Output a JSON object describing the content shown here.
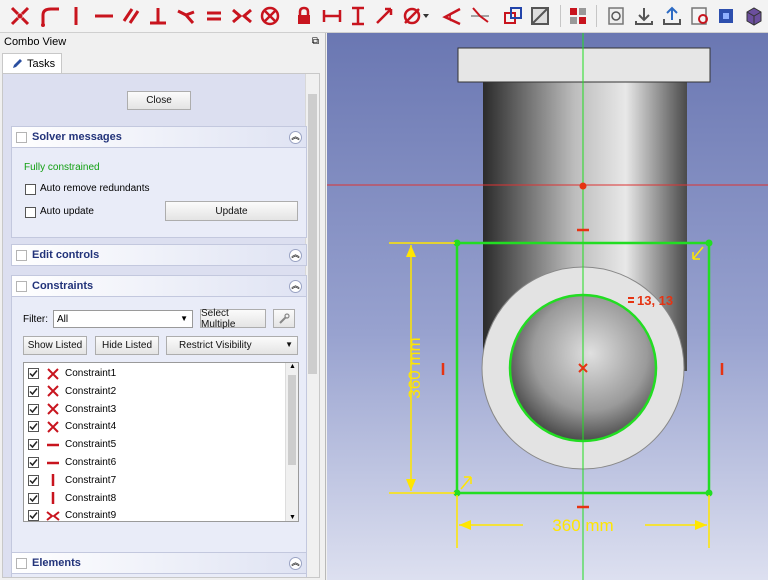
{
  "combo_view": {
    "title": "Combo View",
    "float_glyph": "⧉",
    "tab_label": "Tasks"
  },
  "tasks": {
    "close_label": "Close",
    "solver": {
      "title": "Solver messages",
      "status": "Fully constrained",
      "status_color": "#12a012",
      "auto_remove_label": "Auto remove redundants",
      "auto_update_label": "Auto update",
      "update_label": "Update"
    },
    "edit_controls_title": "Edit controls",
    "constraints": {
      "title": "Constraints",
      "filter_label": "Filter:",
      "filter_value": "All",
      "select_multiple_label": "Select Multiple",
      "show_listed_label": "Show Listed",
      "hide_listed_label": "Hide Listed",
      "restrict_visibility_label": "Restrict Visibility",
      "items": [
        {
          "name": "Constraint1",
          "icon": "coincident"
        },
        {
          "name": "Constraint2",
          "icon": "coincident"
        },
        {
          "name": "Constraint3",
          "icon": "coincident"
        },
        {
          "name": "Constraint4",
          "icon": "coincident"
        },
        {
          "name": "Constraint5",
          "icon": "horizontal"
        },
        {
          "name": "Constraint6",
          "icon": "horizontal"
        },
        {
          "name": "Constraint7",
          "icon": "vertical"
        },
        {
          "name": "Constraint8",
          "icon": "vertical"
        },
        {
          "name": "Constraint9",
          "icon": "symmetric"
        }
      ]
    },
    "elements_title": "Elements"
  },
  "viewport": {
    "dimension_vertical": "360 mm",
    "dimension_horizontal": "360 mm",
    "equal_label": "13, 13",
    "accent_green": "#22dd22",
    "dimension_yellow": "#ffe600",
    "constraint_red": "#e63312"
  },
  "toolbar_icons": [
    "coincident-icon",
    "point-on-object-icon",
    "vertical-icon",
    "horizontal-icon",
    "parallel-icon",
    "perpendicular-icon",
    "tangent-icon",
    "equal-icon",
    "symmetric-icon",
    "block-icon",
    "lock-icon",
    "horizontal-distance-icon",
    "vertical-distance-icon",
    "distance-icon",
    "diameter-icon",
    "angle-icon",
    "snell-law-icon",
    "toggle-construction-icon",
    "toggle-driving-icon",
    "validate-sketch-icon",
    "reorient-icon",
    "close-shape-icon",
    "leave-sketch-icon",
    "view-sketch-icon",
    "section-icon"
  ],
  "colors": {
    "panel_title": "#22337a",
    "sketch_red": "#cc1a1a"
  }
}
